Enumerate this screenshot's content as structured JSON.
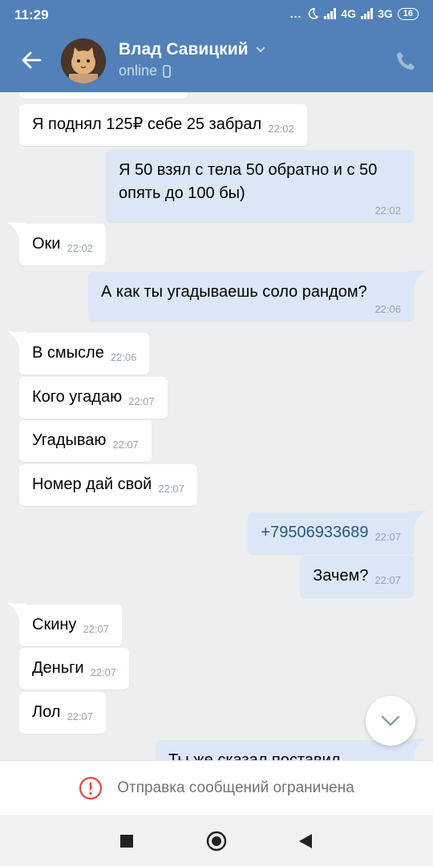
{
  "status_bar": {
    "time": "11:29",
    "dots": "...",
    "network1": "4G",
    "network2": "3G",
    "battery": "16"
  },
  "header": {
    "contact_name": "Влад Савицкий",
    "contact_status": "online",
    "bg_color": "#5181b8"
  },
  "messages": [
    {
      "dir": "in",
      "text": "Я поднял 125₽ себе 25 забрал",
      "time": "22:02"
    },
    {
      "dir": "out",
      "text": "Я 50 взял с тела 50 обратно и с 50 опять до 100 бы)",
      "time": "22:02"
    },
    {
      "dir": "in",
      "text": "Оки",
      "time": "22:02"
    },
    {
      "dir": "out",
      "text": "А как ты угадываешь соло рандом?",
      "time": "22:06"
    },
    {
      "dir": "in",
      "text": "В смысле",
      "time": "22:06"
    },
    {
      "dir": "in",
      "text": "Кого угадаю",
      "time": "22:07"
    },
    {
      "dir": "in",
      "text": "Угадываю",
      "time": "22:07"
    },
    {
      "dir": "in",
      "text": "Номер дай свой",
      "time": "22:07"
    },
    {
      "dir": "out",
      "text": "+79506933689",
      "time": "22:07"
    },
    {
      "dir": "out",
      "text": "Зачем?",
      "time": "22:07"
    },
    {
      "dir": "in",
      "text": "Скину",
      "time": "22:07"
    },
    {
      "dir": "in",
      "text": "Деньги",
      "time": "22:07"
    },
    {
      "dir": "in",
      "text": "Лол",
      "time": "22:07"
    },
    {
      "dir": "out",
      "text": "Ты же сказал поставил",
      "time": ""
    }
  ],
  "banner": {
    "text": "Отправка сообщений ограничена",
    "icon": "alert-circle-icon",
    "icon_color": "#e64646"
  },
  "colors": {
    "incoming": "#ffffff",
    "outgoing": "#dbe7f6",
    "chat_bg": "#edeef0",
    "link": "#2a5885"
  }
}
